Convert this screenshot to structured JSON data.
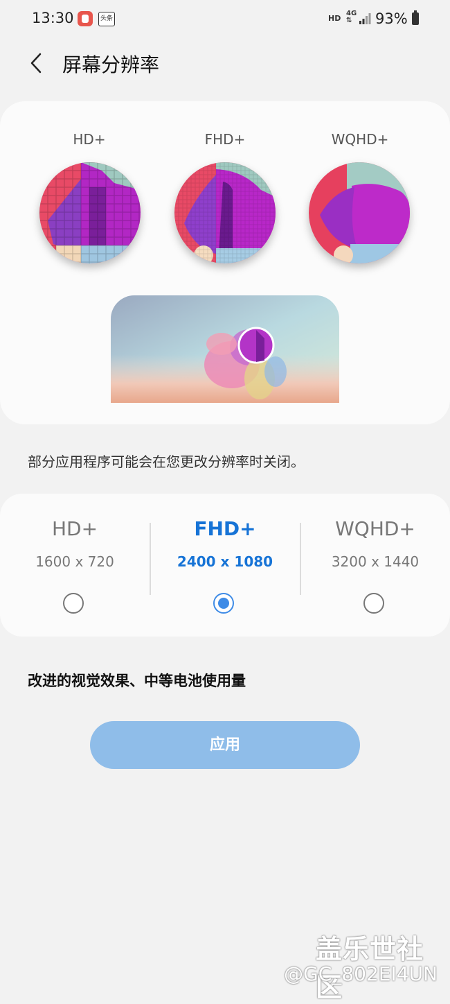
{
  "status_bar": {
    "time": "13:30",
    "app_icon_2_text": "头条",
    "hd_label": "HD",
    "network": "4G",
    "battery_percent": "93%"
  },
  "header": {
    "title": "屏幕分辨率",
    "back_icon": "chevron-left-icon"
  },
  "preview": {
    "labels": [
      "HD+",
      "FHD+",
      "WQHD+"
    ]
  },
  "note": "部分应用程序可能会在您更改分辨率时关闭。",
  "options": [
    {
      "name": "HD+",
      "resolution": "1600 x 720",
      "selected": false
    },
    {
      "name": "FHD+",
      "resolution": "2400 x 1080",
      "selected": true
    },
    {
      "name": "WQHD+",
      "resolution": "3200 x 1440",
      "selected": false
    }
  ],
  "description": "改进的视觉效果、中等电池使用量",
  "apply_button": "应用",
  "watermark": {
    "brand": "盖乐世社区",
    "user": "@GC_802EI4UN"
  },
  "colors": {
    "accent": "#1673d6",
    "radio_selected": "#3e8be6",
    "button": "#8fbde9",
    "background": "#f2f2f2"
  }
}
